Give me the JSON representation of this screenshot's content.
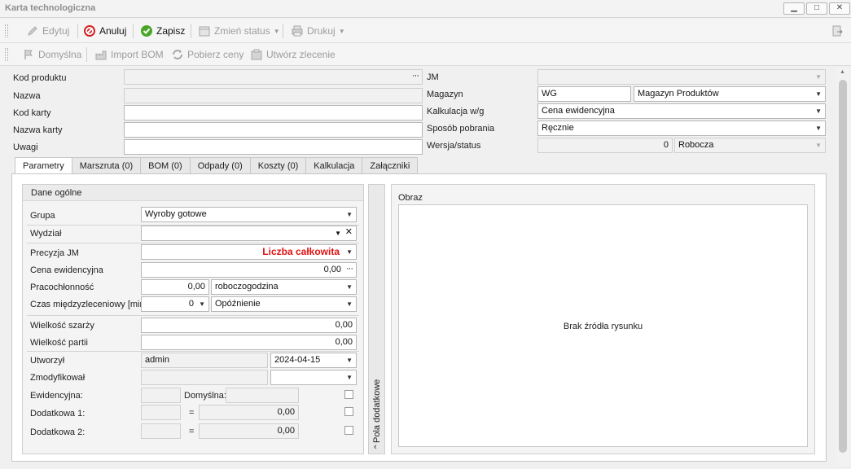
{
  "window": {
    "title": "Karta technologiczna",
    "controls": {
      "minimize": "▁",
      "maximize": "□",
      "close": "✕"
    }
  },
  "toolbar1": {
    "edit": "Edytuj",
    "cancel": "Anuluj",
    "save": "Zapisz",
    "change_status": "Zmień status",
    "print": "Drukuj"
  },
  "toolbar2": {
    "default": "Domyślna",
    "import_bom": "Import BOM",
    "fetch_prices": "Pobierz ceny",
    "create_order": "Utwórz zlecenie"
  },
  "header_left": {
    "product_code_label": "Kod produktu",
    "product_code_value": "",
    "name_label": "Nazwa",
    "name_value": "",
    "card_code_label": "Kod karty",
    "card_code_value": "",
    "card_name_label": "Nazwa karty",
    "card_name_value": "",
    "notes_label": "Uwagi",
    "notes_value": ""
  },
  "header_right": {
    "uom_label": "JM",
    "uom_value": "",
    "warehouse_label": "Magazyn",
    "warehouse_code": "WG",
    "warehouse_name": "Magazyn Produktów",
    "calc_label": "Kalkulacja w/g",
    "calc_value": "Cena ewidencyjna",
    "method_label": "Sposób pobrania",
    "method_value": "Ręcznie",
    "version_label": "Wersja/status",
    "version_number": "0",
    "version_status": "Robocza"
  },
  "tabs": [
    "Parametry",
    "Marszruta (0)",
    "BOM (0)",
    "Odpady (0)",
    "Koszty (0)",
    "Kalkulacja",
    "Załączniki"
  ],
  "general": {
    "title": "Dane ogólne",
    "group_label": "Grupa",
    "group_value": "Wyroby gotowe",
    "dept_label": "Wydział",
    "dept_value": "",
    "precision_label": "Precyzja JM",
    "precision_value": "Liczba całkowita",
    "price_label": "Cena ewidencyjna",
    "price_value": "0,00",
    "labor_label": "Pracochłonność",
    "labor_value": "0,00",
    "labor_unit": "roboczogodzina",
    "interval_label": "Czas międzyzleceniowy [min]",
    "interval_value": "0",
    "interval_type": "Opóźnienie",
    "batch_size_label": "Wielkość szarży",
    "batch_size_value": "0,00",
    "lot_size_label": "Wielkość partii",
    "lot_size_value": "0,00",
    "created_by_label": "Utworzył",
    "created_by_value": "admin",
    "created_date": "2024-04-15",
    "modified_by_label": "Zmodyfikował",
    "modified_by_value": "",
    "modified_date": "",
    "record_label": "Ewidencyjna:",
    "record_value": "",
    "default_label": "Domyślna:",
    "default_value": "",
    "extra1_label": "Dodatkowa 1:",
    "extra1_value": "0,00",
    "extra2_label": "Dodatkowa 2:",
    "extra2_value": "0,00",
    "equals": "="
  },
  "side_panel": {
    "label": "Pola dodatkowe",
    "chevron": "‹"
  },
  "image": {
    "title": "Obraz",
    "empty_text": "Brak źródła rysunku"
  },
  "colors": {
    "precision_text": "#e01010",
    "cancel_icon": "#d42020",
    "save_icon": "#4aa628"
  }
}
